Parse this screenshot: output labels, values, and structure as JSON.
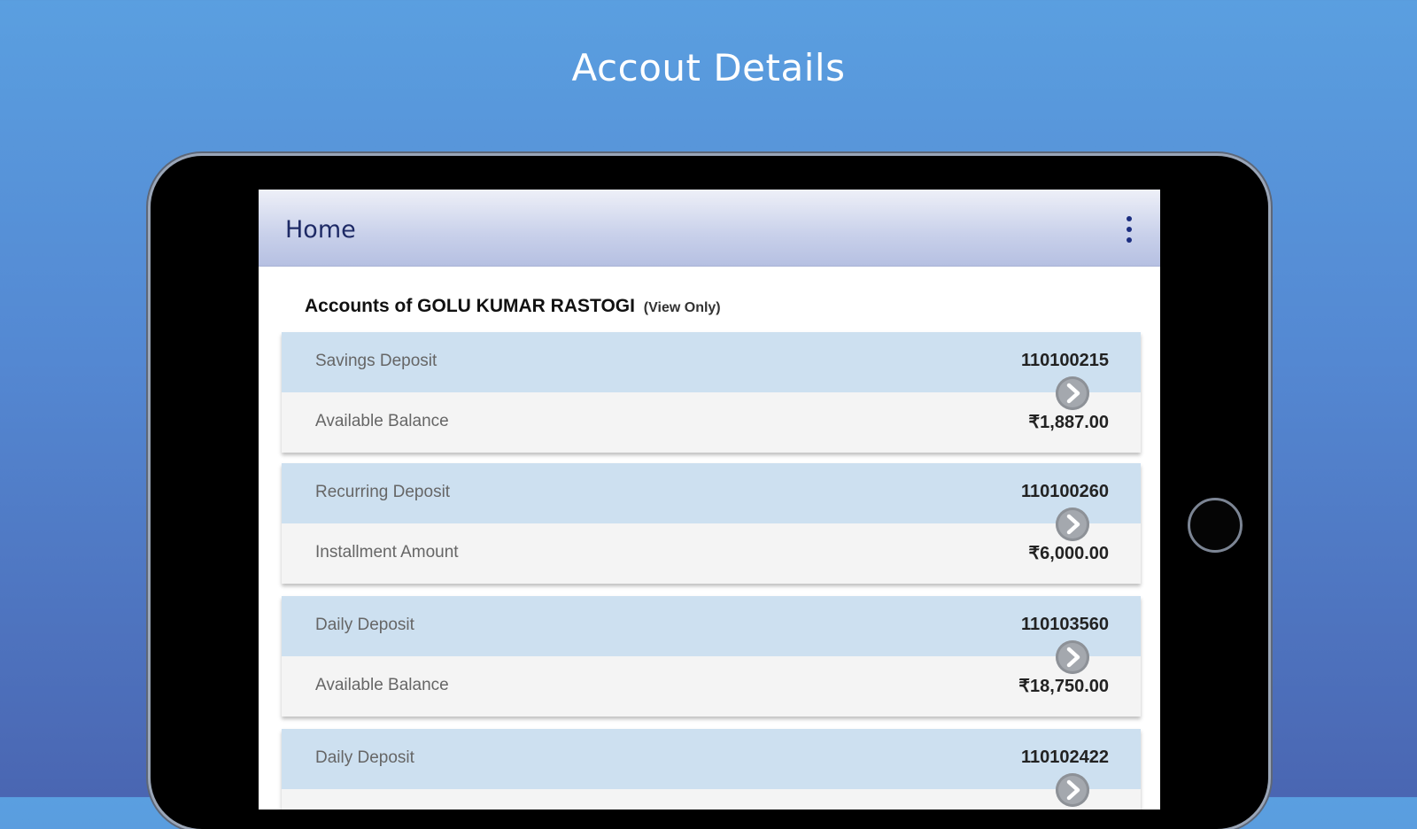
{
  "promo": {
    "title": "Accout Details"
  },
  "app_bar": {
    "title": "Home",
    "menu_icon": "more-vertical-icon"
  },
  "owner": {
    "prefix": "Accounts of GOLU KUMAR RASTOGI",
    "suffix": "(View Only)"
  },
  "accounts": [
    {
      "type": "Savings Deposit",
      "number": "110100215",
      "amount_label": "Available Balance",
      "amount": "₹1,887.00"
    },
    {
      "type": "Recurring Deposit",
      "number": "110100260",
      "amount_label": "Installment Amount",
      "amount": "₹6,000.00"
    },
    {
      "type": "Daily Deposit",
      "number": "110103560",
      "amount_label": "Available Balance",
      "amount": "₹18,750.00"
    },
    {
      "type": "Daily Deposit",
      "number": "110102422",
      "amount_label": "",
      "amount": ""
    }
  ],
  "colors": {
    "background": "#5488d2",
    "card_header": "#cde0f0",
    "card_body": "#f4f4f4",
    "app_bar_text": "#1e2a66"
  }
}
